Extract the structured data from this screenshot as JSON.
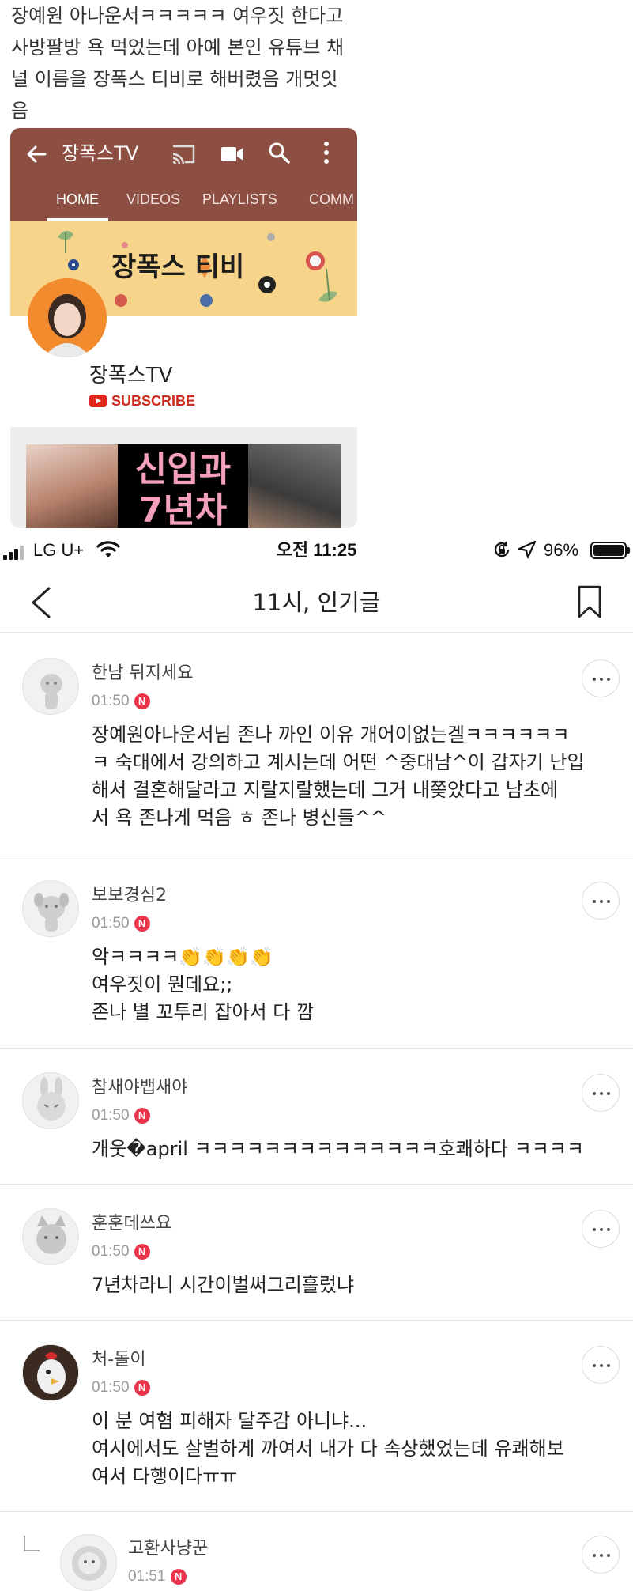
{
  "post": {
    "lines": [
      "장예원 아나운서ㅋㅋㅋㅋㅋ 여우짓 한다고",
      "사방팔방 욕 먹었는데 아예 본인 유튜브 채",
      "널 이름을 장폭스 티비로 해버렸음 개멋잇",
      "음"
    ]
  },
  "youtube": {
    "channel_title": "장폭스TV",
    "tabs": [
      "HOME",
      "VIDEOS",
      "PLAYLISTS",
      "COMM"
    ],
    "active_tab": "HOME",
    "banner_text": "장폭스 티비",
    "channel_name": "장폭스TV",
    "subscribe_label": "SUBSCRIBE",
    "thumbnail_text_1": "신입과",
    "thumbnail_text_2": "7년차",
    "colors": {
      "topbar": "#8e4f43",
      "banner": "#f6d58a",
      "subscribe": "#cc2b1d"
    }
  },
  "statusbar": {
    "carrier": "LG U+",
    "time": "오전 11:25",
    "battery": "96%"
  },
  "nav": {
    "title": "11시, 인기글",
    "back_icon": "chevron-left-icon",
    "bookmark_icon": "bookmark-icon"
  },
  "comments": [
    {
      "username": "한남 뒤지세요",
      "time": "01:50",
      "badge": "N",
      "lines": [
        "장예원아나운서님 존나 까인 이유 개어이없는겔ㅋㅋㅋㅋㅋㅋ",
        "ㅋ 숙대에서 강의하고 계시는데 어떤 ^중대남^이 갑자기 난입",
        "해서 결혼해달라고 지랄지랄했는데 그거 내쫒았다고 남초에",
        "서 욕 존나게 먹음 ㅎ 존나 병신들^^"
      ]
    },
    {
      "username": "보보경심2",
      "time": "01:50",
      "badge": "N",
      "lines": [
        "악ㅋㅋㅋㅋ👏👏👏👏",
        "여우짓이 뭔데요;;",
        "존나 별 꼬투리 잡아서 다 깜"
      ]
    },
    {
      "username": "참새야뱁새야",
      "time": "01:50",
      "badge": "N",
      "lines": [
        "개웃�april ㅋㅋㅋㅋㅋㅋㅋㅋㅋㅋㅋㅋㅋㅋ호쾌하다 ㅋㅋㅋㅋ"
      ]
    },
    {
      "username": "훈훈데쓰요",
      "time": "01:50",
      "badge": "N",
      "lines": [
        "7년차라니 시간이벌써그리흘렀냐"
      ]
    },
    {
      "username": "처-돌이",
      "time": "01:50",
      "badge": "N",
      "lines": [
        "이 분 여혐 피해자 달주감 아니냐...",
        "여시에서도 살벌하게 까여서 내가 다 속상했었는데 유쾌해보",
        "여서 다행이다ㅠㅠ"
      ]
    },
    {
      "username": "고환사냥꾼",
      "time": "01:51",
      "badge": "N",
      "lines": []
    }
  ]
}
